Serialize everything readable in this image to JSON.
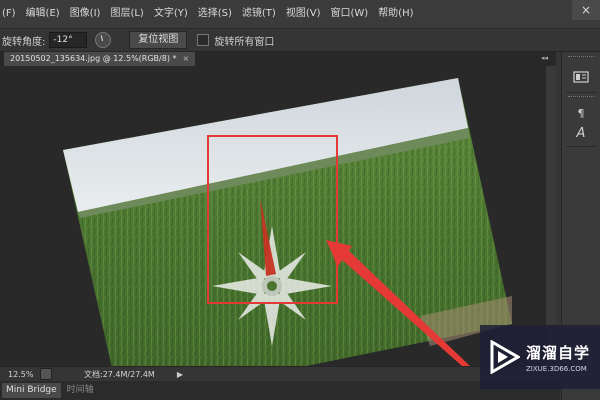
{
  "menu": {
    "items": [
      "(F)",
      "编辑(E)",
      "图像(I)",
      "图层(L)",
      "文字(Y)",
      "选择(S)",
      "滤镜(T)",
      "视图(V)",
      "窗口(W)",
      "帮助(H)"
    ],
    "close_glyph": "×"
  },
  "options": {
    "rotate_label": "旋转角度:",
    "rotate_value": "-12°",
    "reset_button": "复位视图",
    "rotate_all_label": "旋转所有窗口"
  },
  "document": {
    "tab_title": "20150502_135634.jpg @ 12.5%(RGB/8) *",
    "tab_close": "×",
    "collapse": "◂◂"
  },
  "status": {
    "zoom": "12.5%",
    "doc_size": "文档:27.4M/27.4M",
    "arrow": "▶"
  },
  "bottom_tabs": [
    "Mini Bridge",
    "时间轴"
  ],
  "right_panel": {
    "icons": [
      "history-icon",
      "paragraph-icon",
      "character-icon"
    ],
    "paragraph_glyph": "¶",
    "character_glyph": "A"
  },
  "watermark": {
    "title": "溜溜自学",
    "url": "ZIXUE.3D66.COM"
  },
  "colors": {
    "annotation_red": "#e53935",
    "sky": "#dfe5ea",
    "field_green": "#4c7a33",
    "watermark_bg": "#1e1e37"
  }
}
